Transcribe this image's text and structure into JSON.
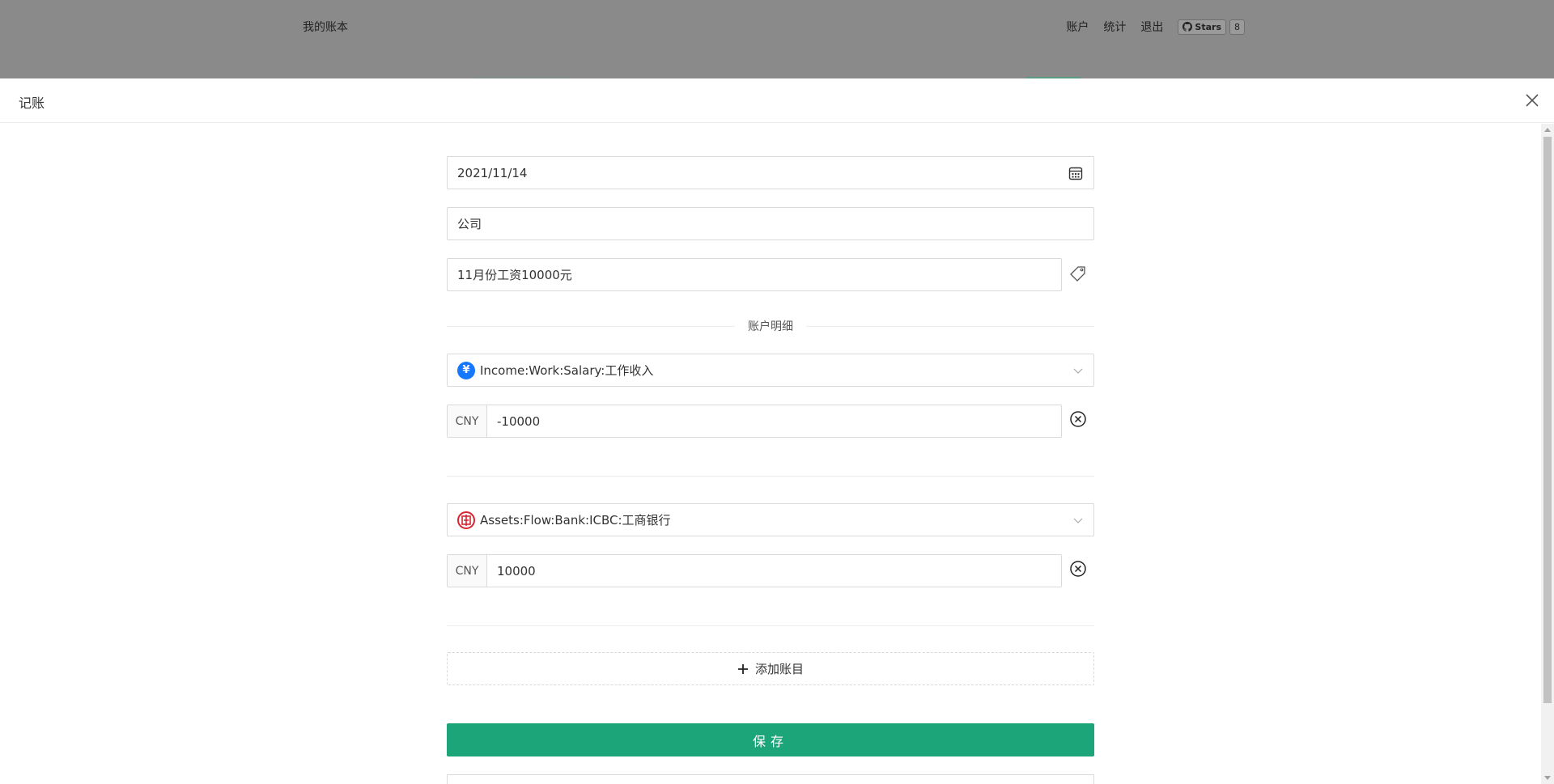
{
  "header": {
    "brand": "我的账本",
    "nav": [
      "账户",
      "统计",
      "退出"
    ],
    "github": {
      "label": "Stars",
      "count": "8"
    }
  },
  "drawer": {
    "title": "记账",
    "date": "2021/11/14",
    "payee": "公司",
    "narration": "11月份工资10000元",
    "section_label": "账户明细",
    "entries": [
      {
        "account": "Income:Work:Salary:工作收入",
        "icon": "yen-coin-icon",
        "currency": "CNY",
        "amount": "-10000"
      },
      {
        "account": "Assets:Flow:Bank:ICBC:工商银行",
        "icon": "icbc-bank-icon",
        "currency": "CNY",
        "amount": "10000"
      }
    ],
    "add_label": "添加账目",
    "save_label": "保存"
  },
  "colors": {
    "primary": "#1da57a",
    "overlay": "#8a8a8a",
    "income_icon": "#1677ff",
    "bank_icon": "#d9242f"
  }
}
